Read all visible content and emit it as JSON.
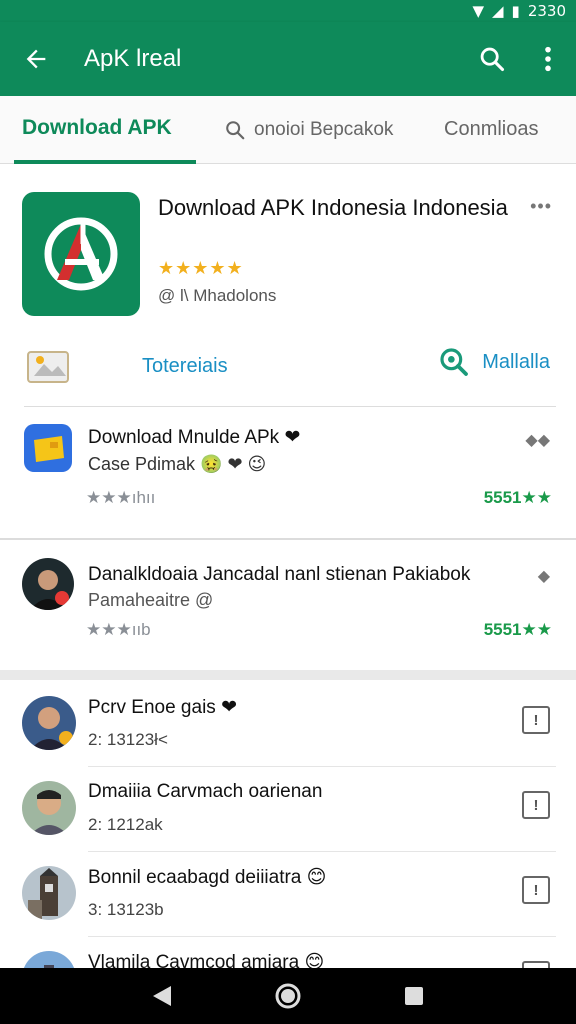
{
  "status_bar": {
    "time": "2330"
  },
  "app_bar": {
    "title": "ApK lreal"
  },
  "tabs": [
    {
      "label": "Download APK"
    },
    {
      "label": "onoioi Bepcakok"
    },
    {
      "label": "Conmlioas"
    }
  ],
  "app": {
    "title": "Download APK Indonesia Indonesia",
    "rating": "★★★★★",
    "meta": "@ l\\ Mhadolons",
    "tutorial_label": "Totereiais",
    "mail_label": "Mallalla"
  },
  "feed": [
    {
      "title": "Download Mnulde APk ❤",
      "subtitle": "Case Pdimak 🤢 ❤ 😉",
      "stars": "★★★ıhıı",
      "score": "5551★★"
    },
    {
      "title": "Danalkldoaia Jancadal nanl stienan Pakiabok",
      "subtitle": "Pamaheaitre @",
      "stars": "★★★ııb",
      "score": "5551★★"
    }
  ],
  "list": [
    {
      "name": "Pcrv Enoe gais ❤",
      "meta": "2: 13123ł<",
      "action": "!"
    },
    {
      "name": "Dmaiiia Carvmach oarienan",
      "meta": "2: 1212ak",
      "action": "!"
    },
    {
      "name": "Bonnil ecaabagd deiiiatra 😊",
      "meta": "3: 13123b",
      "action": "!"
    },
    {
      "name": "Vlamila Cavmcod amiara 😊",
      "meta": "",
      "action": "!"
    }
  ],
  "colors": {
    "primary": "#0e8a5a",
    "accent": "#1a8fc4",
    "rating": "#f2b01e",
    "score": "#1a9a4a"
  }
}
